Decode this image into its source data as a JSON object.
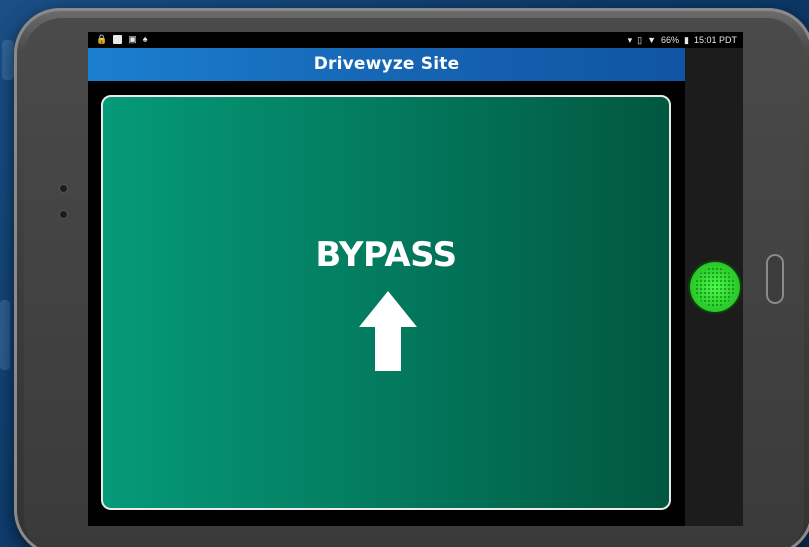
{
  "status_bar": {
    "time": "15:01 PDT",
    "battery": "66%"
  },
  "app_bar": {
    "title": "Drivewyze Site"
  },
  "bypass_card": {
    "text": "BYPASS"
  },
  "colors": {
    "app_bar": "#1b7fd0",
    "bypass_card": "#059a78",
    "status_light": "#2fd32f"
  },
  "icons": [
    "lock-icon",
    "notification-icon",
    "image-icon",
    "android-icon",
    "location-icon",
    "vibrate-icon",
    "wifi-icon",
    "battery-icon",
    "arrow-up-icon"
  ]
}
